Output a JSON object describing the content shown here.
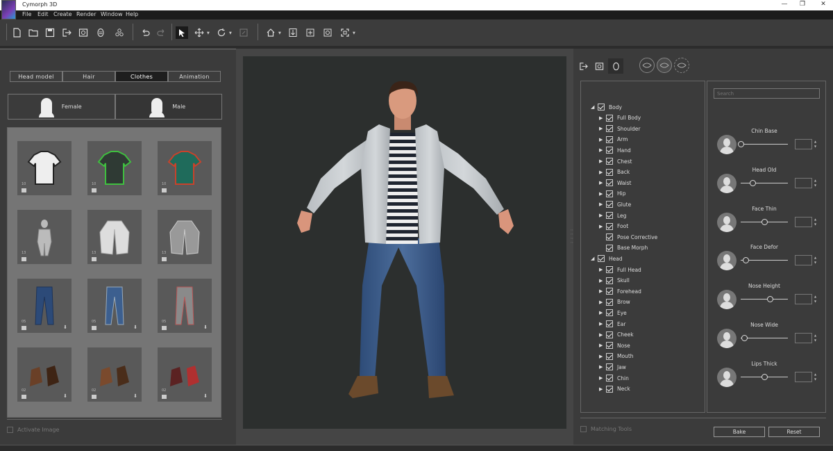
{
  "window": {
    "title": "Cymorph 3D",
    "minimize": "—",
    "restore": "❐",
    "close": "✕"
  },
  "menu": [
    "File",
    "Edit",
    "Create",
    "Render",
    "Window",
    "Help"
  ],
  "left_panel": {
    "tabs": [
      "Head model",
      "Hair",
      "Clothes",
      "Animation"
    ],
    "selected_tab": "Clothes",
    "gender": {
      "female": "Female",
      "male": "Male"
    },
    "clothes": [
      {
        "kind": "tshirt-striped",
        "level": "10",
        "icon": "shirt-icon",
        "download": false
      },
      {
        "kind": "tshirt-green",
        "level": "10",
        "icon": "shirt-icon",
        "download": false
      },
      {
        "kind": "tshirt-flame",
        "level": "10",
        "icon": "shirt-icon",
        "download": false
      },
      {
        "kind": "armor-figure",
        "level": "13",
        "icon": "shirt-icon",
        "download": false
      },
      {
        "kind": "blazer-white",
        "level": "13",
        "icon": "shirt-icon",
        "download": false
      },
      {
        "kind": "blazer-grey",
        "level": "13",
        "icon": "shirt-icon",
        "download": false
      },
      {
        "kind": "jeans-dark",
        "level": "05",
        "icon": "shirt-icon",
        "download": true
      },
      {
        "kind": "jeans-ripped",
        "level": "05",
        "icon": "shirt-icon",
        "download": true
      },
      {
        "kind": "jeans-grey",
        "level": "05",
        "icon": "shirt-icon",
        "download": true
      },
      {
        "kind": "boots-brown",
        "level": "02",
        "icon": "shoe-icon",
        "download": true
      },
      {
        "kind": "boots-tan",
        "level": "02",
        "icon": "shoe-icon",
        "download": true
      },
      {
        "kind": "boots-red",
        "level": "02",
        "icon": "shoe-icon",
        "download": true
      }
    ],
    "activate_image": "Activate Image"
  },
  "tree": [
    {
      "label": "Body",
      "level": 0,
      "arrow": "expanded"
    },
    {
      "label": "Full Body",
      "level": 1,
      "arrow": "collapsed"
    },
    {
      "label": "Shoulder",
      "level": 1,
      "arrow": "collapsed"
    },
    {
      "label": "Arm",
      "level": 1,
      "arrow": "collapsed"
    },
    {
      "label": "Hand",
      "level": 1,
      "arrow": "collapsed"
    },
    {
      "label": "Chest",
      "level": 1,
      "arrow": "collapsed"
    },
    {
      "label": "Back",
      "level": 1,
      "arrow": "collapsed"
    },
    {
      "label": "Waist",
      "level": 1,
      "arrow": "collapsed"
    },
    {
      "label": "Hip",
      "level": 1,
      "arrow": "collapsed"
    },
    {
      "label": "Glute",
      "level": 1,
      "arrow": "collapsed"
    },
    {
      "label": "Leg",
      "level": 1,
      "arrow": "collapsed"
    },
    {
      "label": "Foot",
      "level": 1,
      "arrow": "collapsed"
    },
    {
      "label": "Pose Corrective",
      "level": 1,
      "arrow": "none"
    },
    {
      "label": "Base Morph",
      "level": 1,
      "arrow": "none"
    },
    {
      "label": "Head",
      "level": 0,
      "arrow": "expanded"
    },
    {
      "label": "Full Head",
      "level": 1,
      "arrow": "collapsed"
    },
    {
      "label": "Skull",
      "level": 1,
      "arrow": "collapsed"
    },
    {
      "label": "Forehead",
      "level": 1,
      "arrow": "collapsed"
    },
    {
      "label": "Brow",
      "level": 1,
      "arrow": "collapsed"
    },
    {
      "label": "Eye",
      "level": 1,
      "arrow": "collapsed"
    },
    {
      "label": "Ear",
      "level": 1,
      "arrow": "collapsed"
    },
    {
      "label": "Cheek",
      "level": 1,
      "arrow": "collapsed"
    },
    {
      "label": "Nose",
      "level": 1,
      "arrow": "collapsed"
    },
    {
      "label": "Mouth",
      "level": 1,
      "arrow": "collapsed"
    },
    {
      "label": "Jaw",
      "level": 1,
      "arrow": "collapsed"
    },
    {
      "label": "Chin",
      "level": 1,
      "arrow": "collapsed"
    },
    {
      "label": "Neck",
      "level": 1,
      "arrow": "collapsed"
    }
  ],
  "morph_panel": {
    "search_placeholder": "Search",
    "morphs": [
      {
        "label": "Chin Base",
        "value": 0.0
      },
      {
        "label": "Head Old",
        "value": 0.25
      },
      {
        "label": "Face Thin",
        "value": 0.5
      },
      {
        "label": "Face Defor",
        "value": 0.1
      },
      {
        "label": "Nose Height",
        "value": 0.62
      },
      {
        "label": "Nose Wide",
        "value": 0.08
      },
      {
        "label": "Lips Thick",
        "value": 0.5
      }
    ],
    "bake": "Bake",
    "reset": "Reset"
  },
  "matching_tools": "Matching Tools"
}
